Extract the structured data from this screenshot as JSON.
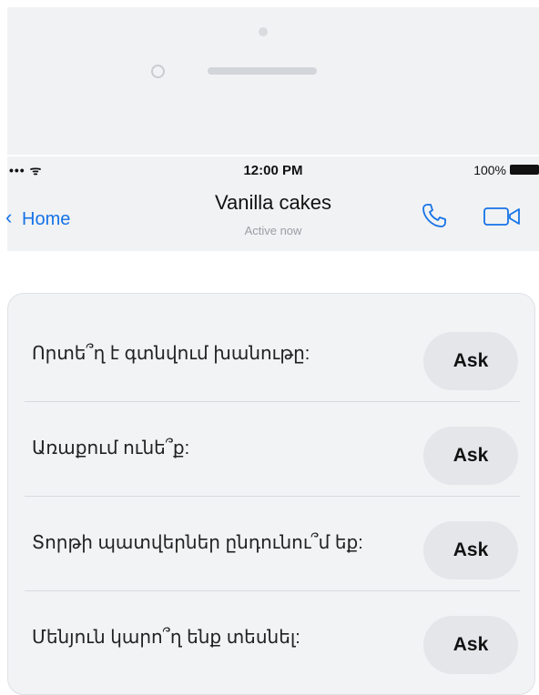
{
  "status_bar": {
    "signal": "••• ᯤ",
    "time": "12:00 PM",
    "battery": "100%"
  },
  "header": {
    "back_label": "Home",
    "title": "Vanilla cakes",
    "subtitle": "Active now",
    "accent": "#1673e6"
  },
  "icons": {
    "call": "phone-icon",
    "video": "video-camera-icon",
    "back": "chevron-left-icon"
  },
  "questions": [
    {
      "text": "Որտե՞ղ է գտնվում խանութը:",
      "button": "Ask"
    },
    {
      "text": "Առաքում ունե՞ք:",
      "button": "Ask"
    },
    {
      "text": "Տորթի պատվերներ ընդունու՞մ եք:",
      "button": "Ask"
    },
    {
      "text": "Մենյուն կարո՞ղ ենք տեսնել:",
      "button": "Ask"
    }
  ]
}
